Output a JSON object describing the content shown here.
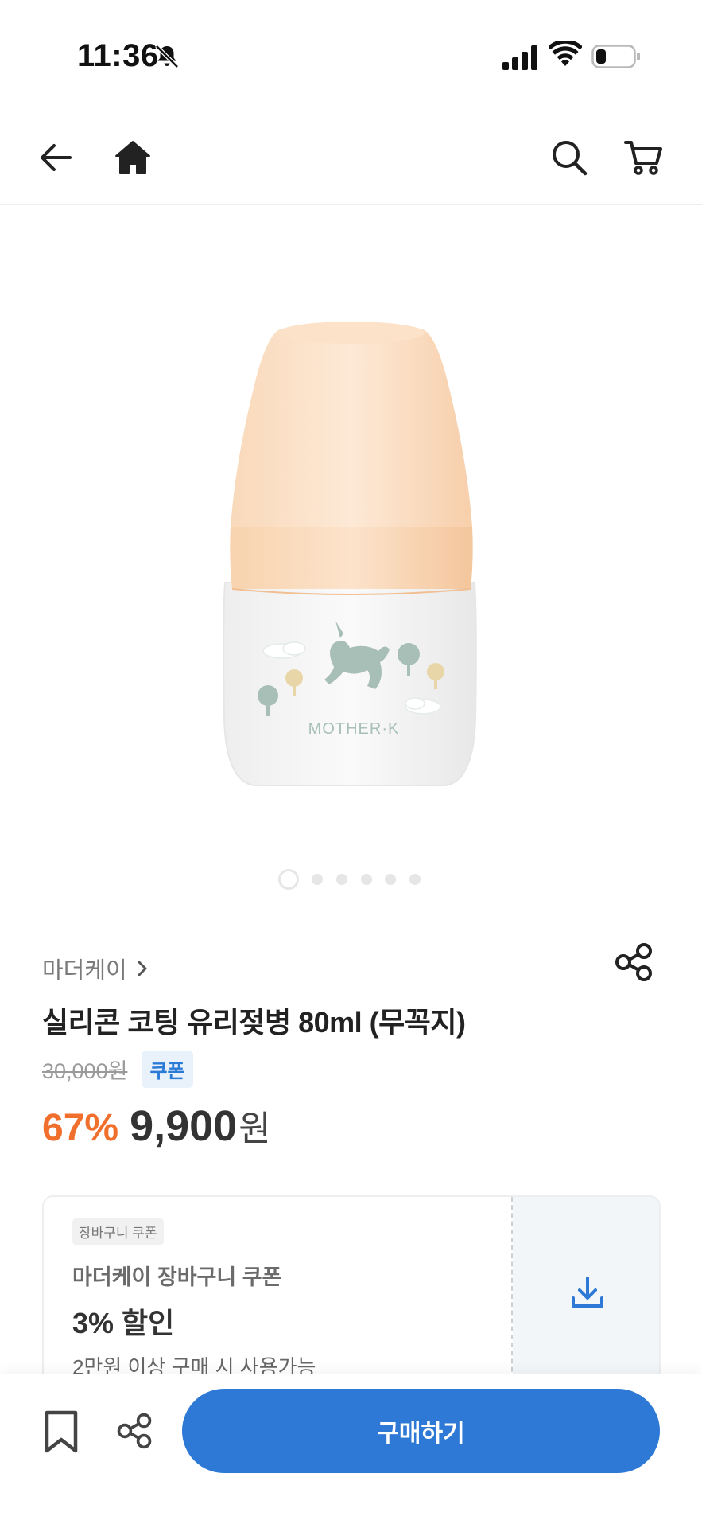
{
  "status_bar": {
    "time": "11:36"
  },
  "nav": {
    "back_icon": "arrow-left-icon",
    "home_icon": "home-icon",
    "search_icon": "search-icon",
    "cart_icon": "cart-icon"
  },
  "product_image": {
    "logo_text": "MOTHER·K"
  },
  "carousel": {
    "total_dots": 6,
    "active_index": 0
  },
  "product": {
    "brand": "마더케이",
    "title": "실리콘 코팅 유리젖병 80ml (무꼭지)",
    "original_price": "30,000원",
    "coupon_badge": "쿠폰",
    "discount_rate": "67%",
    "sale_price": "9,900",
    "currency": "원"
  },
  "coupon": {
    "tag": "장바구니 쿠폰",
    "name": "마더케이 장바구니 쿠폰",
    "discount": "3% 할인",
    "condition": "2만원 이상 구매 시 사용가능",
    "download_icon": "download-icon"
  },
  "bottom_bar": {
    "buy_label": "구매하기",
    "bookmark_icon": "bookmark-icon",
    "share_icon": "share-icon"
  },
  "colors": {
    "accent_blue": "#2d79d5",
    "discount_orange": "#f06f2c",
    "coupon_badge_bg": "#e9f2fb"
  }
}
